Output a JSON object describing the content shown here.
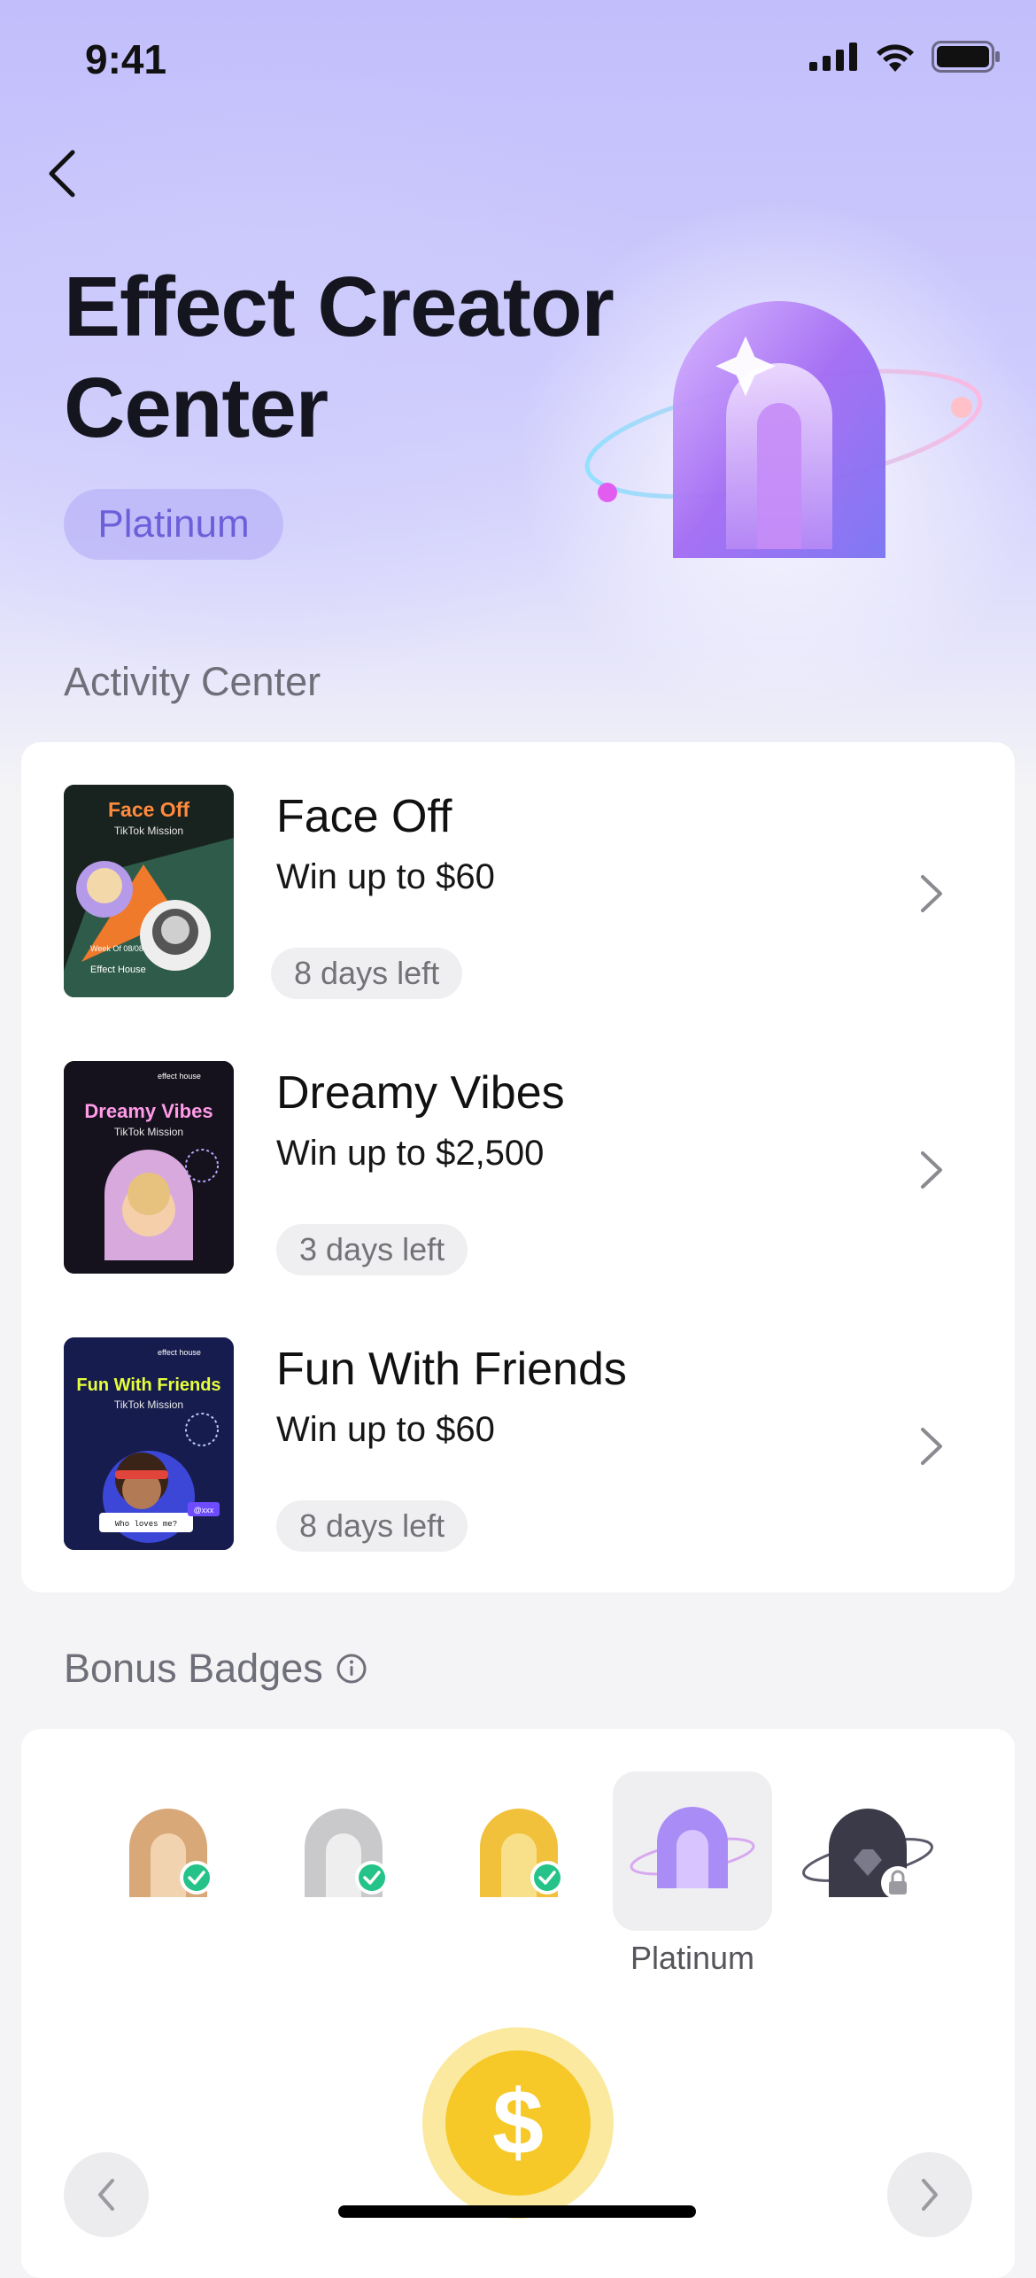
{
  "status_bar": {
    "time": "9:41"
  },
  "header": {
    "title_line1": "Effect Creator",
    "title_line2": "Center",
    "tier": "Platinum"
  },
  "activity_center": {
    "label": "Activity Center",
    "items": [
      {
        "title": "Face Off",
        "prize": "Win up to $60",
        "days_left": "8 days left",
        "thumb": {
          "heading": "Face Off",
          "sub": "TikTok Mission",
          "footer_small": "Week Of 08/08",
          "footer": "Effect House",
          "accent": "#ff8a3d"
        }
      },
      {
        "title": "Dreamy Vibes",
        "prize": "Win up to $2,500",
        "days_left": "3 days left",
        "thumb": {
          "brand": "effect house",
          "heading": "Dreamy Vibes",
          "sub": "TikTok Mission",
          "accent": "#ff9be8"
        }
      },
      {
        "title": "Fun With Friends",
        "prize": "Win up to $60",
        "days_left": "8 days left",
        "thumb": {
          "brand": "effect house",
          "heading": "Fun With Friends",
          "sub": "TikTok Mission",
          "bubble": "Who loves me?",
          "tag": "@xxx",
          "accent": "#e6ff3c"
        }
      }
    ]
  },
  "bonus_badges": {
    "label": "Bonus Badges",
    "badges": [
      {
        "tier": "bronze",
        "status": "earned",
        "color": "#d8a878"
      },
      {
        "tier": "silver",
        "status": "earned",
        "color": "#c9c9cc"
      },
      {
        "tier": "gold",
        "status": "earned",
        "color": "#f1c13b"
      },
      {
        "tier": "platinum",
        "status": "current",
        "color": "#a98cf5"
      },
      {
        "tier": "diamond",
        "status": "locked",
        "color": "#3a3a48"
      }
    ],
    "selected_label": "Platinum"
  },
  "reward": {
    "icon": "dollar-coin-icon",
    "symbol": "$"
  },
  "colors": {
    "accent": "#6c5fd9",
    "check": "#25c38a"
  }
}
